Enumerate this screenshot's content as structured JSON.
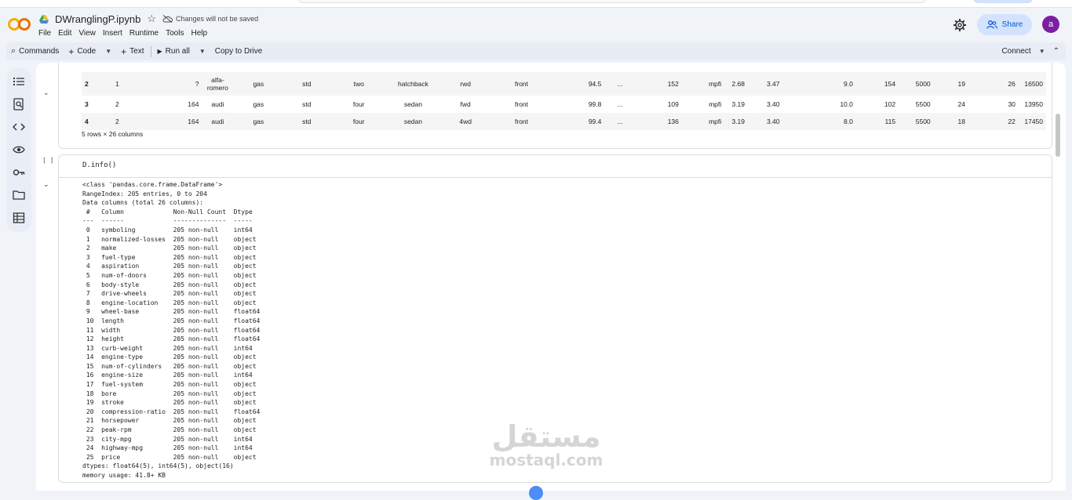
{
  "app": {
    "notebook_title": "DWranglingP.ipynb",
    "save_status": "Changes will not be saved",
    "menu": [
      "File",
      "Edit",
      "View",
      "Insert",
      "Runtime",
      "Tools",
      "Help"
    ],
    "share_label": "Share",
    "avatar_letter": "a",
    "brand_color": "#f9ab00"
  },
  "toolbar": {
    "commands": "Commands",
    "code": "Code",
    "text": "Text",
    "run_all": "Run all",
    "copy_to_drive": "Copy to Drive",
    "connect": "Connect"
  },
  "sidebar": {
    "icons": [
      "table-of-contents-icon",
      "find-icon",
      "code-snippets-icon",
      "variables-icon",
      "secrets-key-icon",
      "files-folder-icon",
      "data-table-icon"
    ]
  },
  "dataframe": {
    "rows": [
      [
        "2",
        "1",
        "?",
        "alfa-romero",
        "gas",
        "std",
        "two",
        "hatchback",
        "rwd",
        "front",
        "94.5",
        "...",
        "152",
        "mpfi",
        "2.68",
        "3.47",
        "9.0",
        "154",
        "5000",
        "19",
        "26",
        "16500"
      ],
      [
        "3",
        "2",
        "164",
        "audi",
        "gas",
        "std",
        "four",
        "sedan",
        "fwd",
        "front",
        "99.8",
        "...",
        "109",
        "mpfi",
        "3.19",
        "3.40",
        "10.0",
        "102",
        "5500",
        "24",
        "30",
        "13950"
      ],
      [
        "4",
        "2",
        "164",
        "audi",
        "gas",
        "std",
        "four",
        "sedan",
        "4wd",
        "front",
        "99.4",
        "...",
        "136",
        "mpfi",
        "3.19",
        "3.40",
        "8.0",
        "115",
        "5500",
        "18",
        "22",
        "17450"
      ]
    ],
    "shape_note": "5 rows × 26 columns"
  },
  "cell2": {
    "exec_count": "[ ]",
    "code": "D.info()"
  },
  "info_output": {
    "header": [
      "<class 'pandas.core.frame.DataFrame'>",
      "RangeIndex: 205 entries, 0 to 204",
      "Data columns (total 26 columns):",
      " #   Column             Non-Null Count  Dtype  ",
      "---  ------             --------------  -----  "
    ],
    "columns": [
      [
        "0",
        "symboling",
        "205 non-null",
        "int64"
      ],
      [
        "1",
        "normalized-losses",
        "205 non-null",
        "object"
      ],
      [
        "2",
        "make",
        "205 non-null",
        "object"
      ],
      [
        "3",
        "fuel-type",
        "205 non-null",
        "object"
      ],
      [
        "4",
        "aspiration",
        "205 non-null",
        "object"
      ],
      [
        "5",
        "num-of-doors",
        "205 non-null",
        "object"
      ],
      [
        "6",
        "body-style",
        "205 non-null",
        "object"
      ],
      [
        "7",
        "drive-wheels",
        "205 non-null",
        "object"
      ],
      [
        "8",
        "engine-location",
        "205 non-null",
        "object"
      ],
      [
        "9",
        "wheel-base",
        "205 non-null",
        "float64"
      ],
      [
        "10",
        "length",
        "205 non-null",
        "float64"
      ],
      [
        "11",
        "width",
        "205 non-null",
        "float64"
      ],
      [
        "12",
        "height",
        "205 non-null",
        "float64"
      ],
      [
        "13",
        "curb-weight",
        "205 non-null",
        "int64"
      ],
      [
        "14",
        "engine-type",
        "205 non-null",
        "object"
      ],
      [
        "15",
        "num-of-cylinders",
        "205 non-null",
        "object"
      ],
      [
        "16",
        "engine-size",
        "205 non-null",
        "int64"
      ],
      [
        "17",
        "fuel-system",
        "205 non-null",
        "object"
      ],
      [
        "18",
        "bore",
        "205 non-null",
        "object"
      ],
      [
        "19",
        "stroke",
        "205 non-null",
        "object"
      ],
      [
        "20",
        "compression-ratio",
        "205 non-null",
        "float64"
      ],
      [
        "21",
        "horsepower",
        "205 non-null",
        "object"
      ],
      [
        "22",
        "peak-rpm",
        "205 non-null",
        "object"
      ],
      [
        "23",
        "city-mpg",
        "205 non-null",
        "int64"
      ],
      [
        "24",
        "highway-mpg",
        "205 non-null",
        "int64"
      ],
      [
        "25",
        "price",
        "205 non-null",
        "object"
      ]
    ],
    "footer": [
      "dtypes: float64(5), int64(5), object(16)",
      "memory usage: 41.8+ KB"
    ]
  },
  "watermark": {
    "arabic": "مستقل",
    "latin": "mostaql.com"
  }
}
